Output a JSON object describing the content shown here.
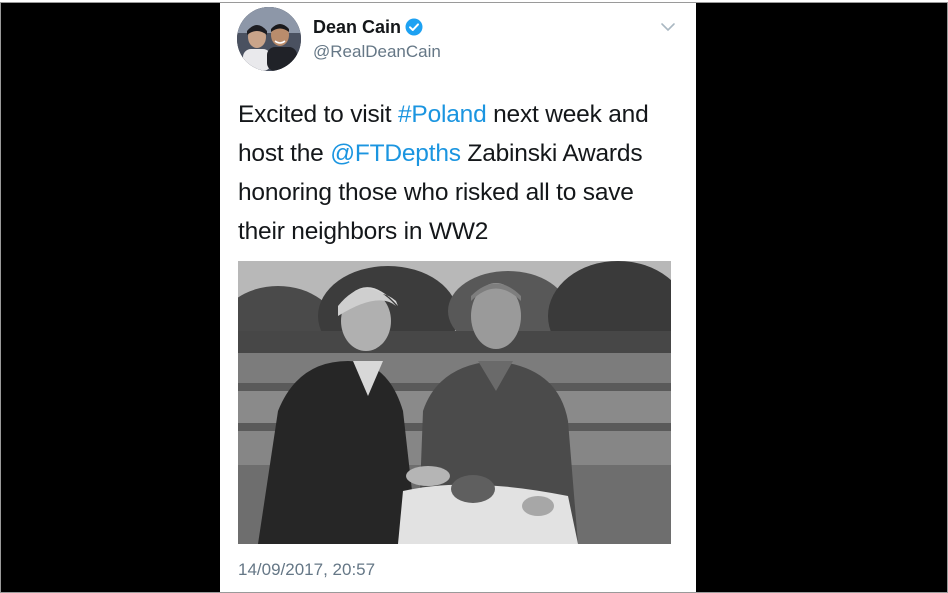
{
  "tweet": {
    "display_name": "Dean Cain",
    "handle": "@RealDeanCain",
    "text_lines": [
      [
        "Excited to visit ",
        "#Poland",
        " next week and"
      ],
      [
        "host the ",
        "@FTDepths",
        " Zabinski Awards"
      ],
      [
        "honoring those who risked all to save"
      ],
      [
        "their neighbors in WW2"
      ]
    ],
    "hashtag": "#Poland",
    "mention": "@FTDepths",
    "timestamp": "14/09/2017, 20:57",
    "icons": {
      "verified": "verified-badge-icon",
      "menu": "chevron-down-icon"
    }
  },
  "colors": {
    "link": "#1b95e0",
    "text": "#14171a",
    "secondary": "#657786",
    "verified": "#1da1f2",
    "background_bars": "#000000"
  }
}
